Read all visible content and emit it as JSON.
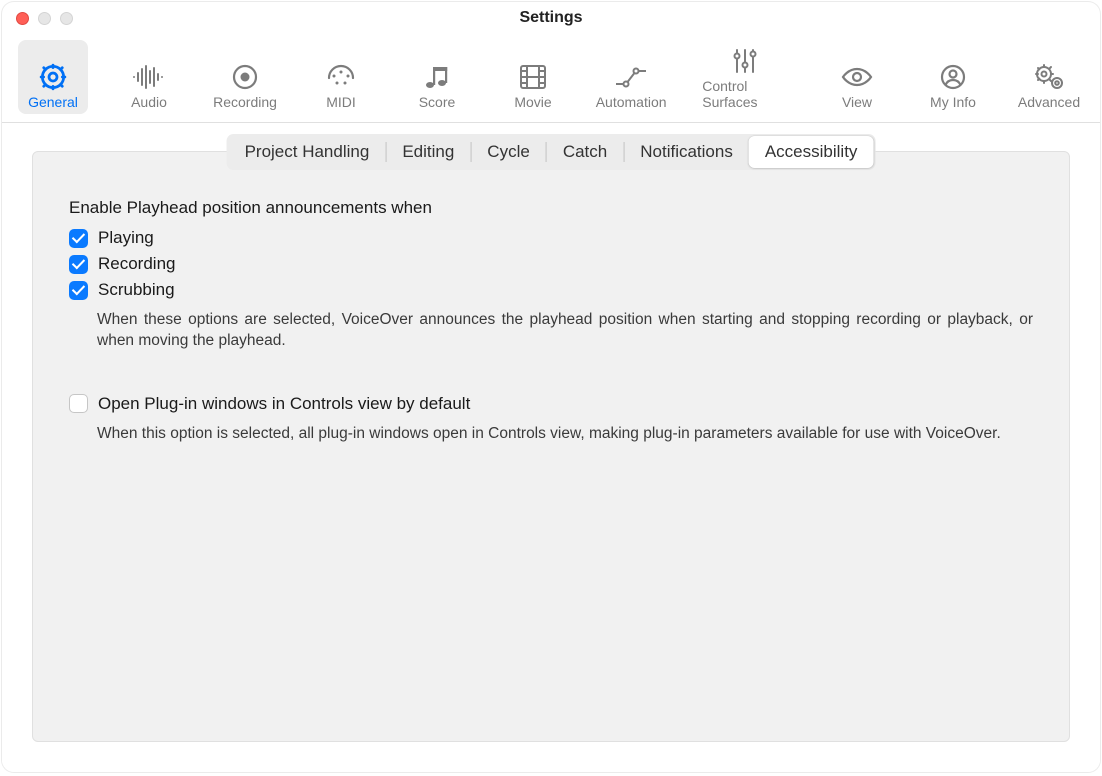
{
  "window": {
    "title": "Settings"
  },
  "toolbar": {
    "items": [
      {
        "label": "General"
      },
      {
        "label": "Audio"
      },
      {
        "label": "Recording"
      },
      {
        "label": "MIDI"
      },
      {
        "label": "Score"
      },
      {
        "label": "Movie"
      },
      {
        "label": "Automation"
      },
      {
        "label": "Control Surfaces"
      },
      {
        "label": "View"
      },
      {
        "label": "My Info"
      },
      {
        "label": "Advanced"
      }
    ],
    "selected": "General"
  },
  "subtabs": {
    "items": [
      {
        "label": "Project Handling"
      },
      {
        "label": "Editing"
      },
      {
        "label": "Cycle"
      },
      {
        "label": "Catch"
      },
      {
        "label": "Notifications"
      },
      {
        "label": "Accessibility"
      }
    ],
    "selected": "Accessibility"
  },
  "section1": {
    "heading": "Enable Playhead position announcements when",
    "options": [
      {
        "label": "Playing",
        "checked": true
      },
      {
        "label": "Recording",
        "checked": true
      },
      {
        "label": "Scrubbing",
        "checked": true
      }
    ],
    "help": "When these options are selected, VoiceOver announces the playhead position when starting and stopping recording or playback, or when moving the playhead."
  },
  "section2": {
    "option": {
      "label": "Open Plug-in windows in Controls view by default",
      "checked": false
    },
    "help": "When this option is selected, all plug-in windows open in Controls view, making plug-in parameters available for use with VoiceOver."
  }
}
